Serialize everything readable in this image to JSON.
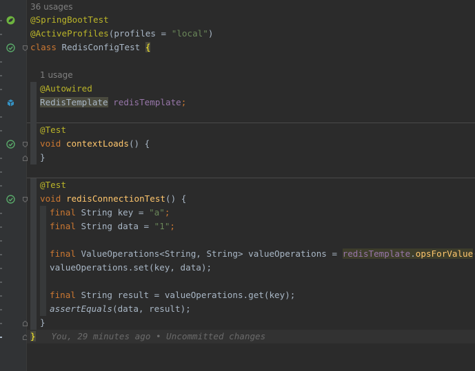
{
  "usages_top": "36 usages",
  "usages_field": "1 usage",
  "code": {
    "l1_ann": "@SpringBootTest",
    "l2_ann": "@ActiveProfiles",
    "l2_rest": "(profiles = ",
    "l2_str": "\"local\"",
    "l2_end": ")",
    "l3_kw": "class",
    "l3_name": " RedisConfigTest ",
    "l3_brace": "{",
    "l5_ann": "@Autowired",
    "l6_type": "RedisTemplate",
    "l6_field": "redisTemplate",
    "l6_end": ";",
    "l8_ann": "@Test",
    "l9_kw": "void",
    "l9_method": "contextLoads",
    "l9_end": "() {",
    "l10": "}",
    "l12_ann": "@Test",
    "l13_kw": "void",
    "l13_method": "redisConnectionTest",
    "l13_end": "() {",
    "l14_kw": "final",
    "l14_rest": " String key = ",
    "l14_str": "\"a\"",
    "l14_end": ";",
    "l15_kw": "final",
    "l15_rest": " String data = ",
    "l15_str": "\"1\"",
    "l15_end": ";",
    "l17_kw": "final",
    "l17_rest": " ValueOperations<String, String> valueOperations = ",
    "l17_field": "redisTemplate",
    "l17_dot": ".",
    "l17_call": "opsForValue",
    "l17_end": "();",
    "l18": "valueOperations.set(key, data);",
    "l20_kw": "final",
    "l20_rest": " String result = valueOperations.get(key);",
    "l21_call": "assertEquals",
    "l21_rest": "(data, result);",
    "l22": "}",
    "l23": "}",
    "blame": "You, 29 minutes ago • Uncommitted changes"
  },
  "icons": {
    "spring": "spring-bean-icon",
    "run": "run-test-icon",
    "bean": "autowired-bean-icon"
  }
}
